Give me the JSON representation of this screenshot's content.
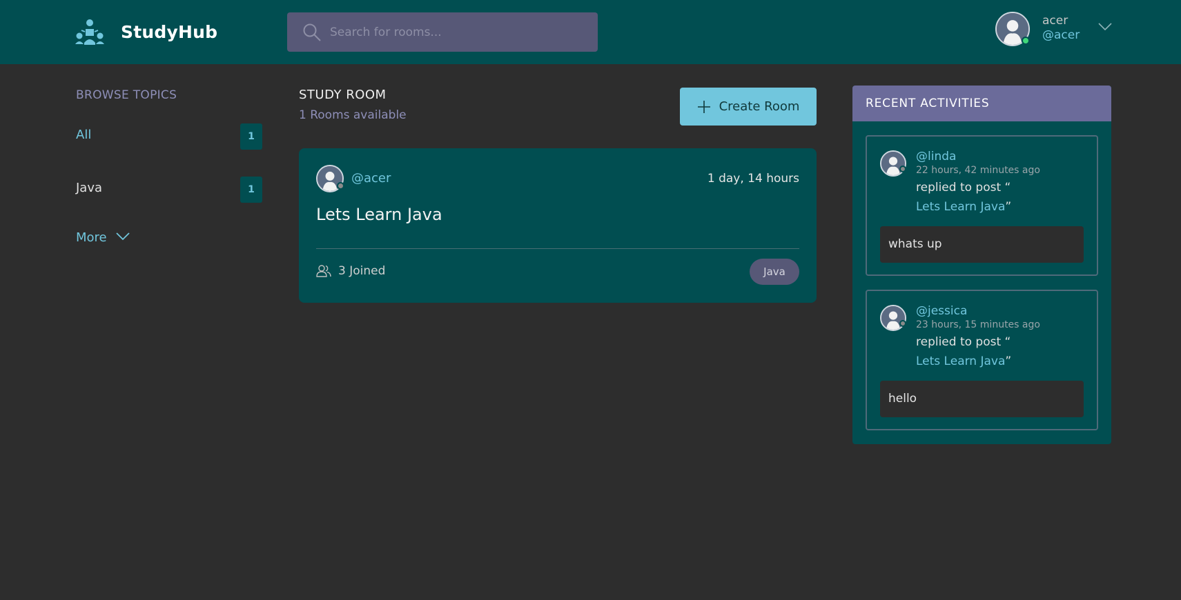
{
  "header": {
    "brand": "StudyHub",
    "search_placeholder": "Search for rooms...",
    "user": {
      "name": "acer",
      "handle": "@acer",
      "status_color": "#40d87a"
    }
  },
  "sidebar": {
    "title": "BROWSE TOPICS",
    "topics": [
      {
        "label": "All",
        "count": "1",
        "active": true
      },
      {
        "label": "Java",
        "count": "1",
        "active": false
      }
    ],
    "more_label": "More"
  },
  "main": {
    "title": "STUDY ROOM",
    "subtitle": "1 Rooms available",
    "create_button": "Create Room",
    "rooms": [
      {
        "host": "@acer",
        "time": "1 day, 14 hours",
        "name": "Lets Learn Java",
        "joined": "3 Joined",
        "topic": "Java"
      }
    ]
  },
  "activities": {
    "title": "RECENT ACTIVITIES",
    "items": [
      {
        "user": "@linda",
        "time": "22 hours, 42 minutes ago",
        "action": "replied to post “",
        "post": "Lets Learn Java",
        "post_close": "”",
        "body": "whats up"
      },
      {
        "user": "@jessica",
        "time": "23 hours, 15 minutes ago",
        "action": "replied to post “",
        "post": "Lets Learn Java",
        "post_close": "”",
        "body": "hello"
      }
    ]
  },
  "colors": {
    "background": "#2d2d2d",
    "header": "#014e51",
    "accent": "#71c6dd",
    "muted_purple": "#8e8fb8",
    "panel_head": "#6b6b9a",
    "tag": "#575877"
  },
  "icons": [
    "studyhub-logo-icon",
    "search-icon",
    "chevron-down-icon",
    "plus-icon",
    "users-icon",
    "avatar-icon"
  ]
}
